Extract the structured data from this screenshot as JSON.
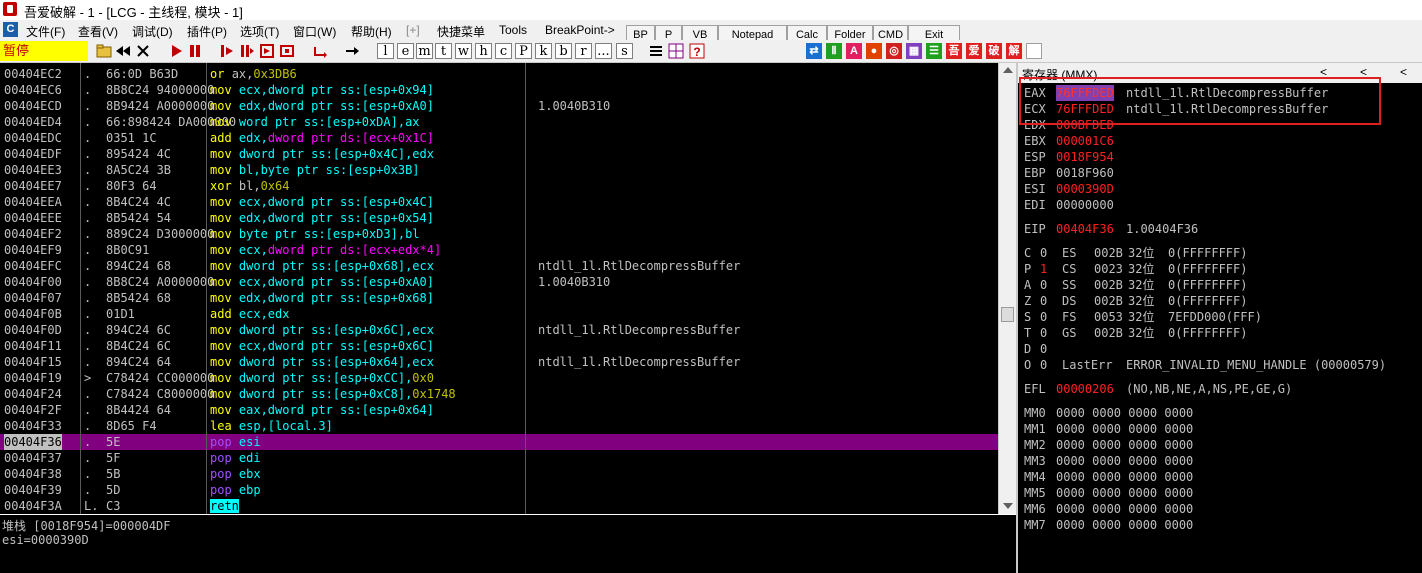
{
  "window": {
    "title": "吾爱破解 - 1 - [LCG - 主线程, 模块 - 1]"
  },
  "menu": {
    "items": [
      "文件(F)",
      "查看(V)",
      "调试(D)",
      "插件(P)",
      "选项(T)",
      "窗口(W)",
      "帮助(H)",
      "[+]",
      "快捷菜单",
      "Tools",
      "BreakPoint->"
    ]
  },
  "toolbar": {
    "status": "暂停",
    "letters": [
      "l",
      "e",
      "m",
      "t",
      "w",
      "h",
      "c",
      "P",
      "k",
      "b",
      "r",
      "...",
      "s"
    ],
    "plugin_buttons": [
      "BP",
      "P",
      "VB",
      "Notepad",
      "Calc",
      "Folder",
      "CMD",
      "Exit"
    ],
    "color_buttons": [
      "⇄",
      "Ⅱ",
      "A",
      "●",
      "◎",
      "▦",
      "☰",
      "吾",
      "爱",
      "破",
      "解"
    ]
  },
  "disasm": {
    "rows": [
      {
        "addr": "00404EC2",
        "mark": ".",
        "hex": "66:0D B63D",
        "asm": [
          {
            "t": "or ",
            "c": "y"
          },
          {
            "t": "ax,",
            "c": "w"
          },
          {
            "t": "0x3DB6",
            "c": "n"
          }
        ],
        "comment": ""
      },
      {
        "addr": "00404EC6",
        "mark": ".",
        "hex": "8B8C24 94000000",
        "asm": [
          {
            "t": "mov ",
            "c": "y"
          },
          {
            "t": "ecx",
            "c": "c"
          },
          {
            "t": ",dword ptr ss:[esp+0x94]",
            "c": "c"
          }
        ],
        "comment": ""
      },
      {
        "addr": "00404ECD",
        "mark": ".",
        "hex": "8B9424 A0000000",
        "asm": [
          {
            "t": "mov ",
            "c": "y"
          },
          {
            "t": "edx",
            "c": "c"
          },
          {
            "t": ",dword ptr ss:[esp+0xA0]",
            "c": "c"
          }
        ],
        "comment": "1.0040B310"
      },
      {
        "addr": "00404ED4",
        "mark": ".",
        "hex": "66:898424 DA000000",
        "asm": [
          {
            "t": "mov ",
            "c": "y"
          },
          {
            "t": "word ptr ss:[esp+0xDA],ax",
            "c": "c"
          }
        ],
        "comment": ""
      },
      {
        "addr": "00404EDC",
        "mark": ".",
        "hex": "0351 1C",
        "asm": [
          {
            "t": "add ",
            "c": "y"
          },
          {
            "t": "edx,",
            "c": "c"
          },
          {
            "t": "dword ptr ds:[ecx+0x1C]",
            "c": "m"
          }
        ],
        "comment": ""
      },
      {
        "addr": "00404EDF",
        "mark": ".",
        "hex": "895424 4C",
        "asm": [
          {
            "t": "mov ",
            "c": "y"
          },
          {
            "t": "dword ptr ss:[esp+0x4C],edx",
            "c": "c"
          }
        ],
        "comment": ""
      },
      {
        "addr": "00404EE3",
        "mark": ".",
        "hex": "8A5C24 3B",
        "asm": [
          {
            "t": "mov ",
            "c": "y"
          },
          {
            "t": "bl,byte ptr ss:[esp+0x3B]",
            "c": "c"
          }
        ],
        "comment": ""
      },
      {
        "addr": "00404EE7",
        "mark": ".",
        "hex": "80F3 64",
        "asm": [
          {
            "t": "xor ",
            "c": "y"
          },
          {
            "t": "bl,",
            "c": "w"
          },
          {
            "t": "0x64",
            "c": "n"
          }
        ],
        "comment": ""
      },
      {
        "addr": "00404EEA",
        "mark": ".",
        "hex": "8B4C24 4C",
        "asm": [
          {
            "t": "mov ",
            "c": "y"
          },
          {
            "t": "ecx,dword ptr ss:[esp+0x4C]",
            "c": "c"
          }
        ],
        "comment": ""
      },
      {
        "addr": "00404EEE",
        "mark": ".",
        "hex": "8B5424 54",
        "asm": [
          {
            "t": "mov ",
            "c": "y"
          },
          {
            "t": "edx,dword ptr ss:[esp+0x54]",
            "c": "c"
          }
        ],
        "comment": ""
      },
      {
        "addr": "00404EF2",
        "mark": ".",
        "hex": "889C24 D3000000",
        "asm": [
          {
            "t": "mov ",
            "c": "y"
          },
          {
            "t": "byte ptr ss:[esp+0xD3],bl",
            "c": "c"
          }
        ],
        "comment": ""
      },
      {
        "addr": "00404EF9",
        "mark": ".",
        "hex": "8B0C91",
        "asm": [
          {
            "t": "mov ",
            "c": "y"
          },
          {
            "t": "ecx,",
            "c": "c"
          },
          {
            "t": "dword ptr ds:[ecx+edx*4]",
            "c": "m"
          }
        ],
        "comment": ""
      },
      {
        "addr": "00404EFC",
        "mark": ".",
        "hex": "894C24 68",
        "asm": [
          {
            "t": "mov ",
            "c": "y"
          },
          {
            "t": "dword ptr ss:[esp+0x68],ecx",
            "c": "c"
          }
        ],
        "comment": "ntdll_1l.RtlDecompressBuffer"
      },
      {
        "addr": "00404F00",
        "mark": ".",
        "hex": "8B8C24 A0000000",
        "asm": [
          {
            "t": "mov ",
            "c": "y"
          },
          {
            "t": "ecx,dword ptr ss:[esp+0xA0]",
            "c": "c"
          }
        ],
        "comment": "1.0040B310"
      },
      {
        "addr": "00404F07",
        "mark": ".",
        "hex": "8B5424 68",
        "asm": [
          {
            "t": "mov ",
            "c": "y"
          },
          {
            "t": "edx,dword ptr ss:[esp+0x68]",
            "c": "c"
          }
        ],
        "comment": ""
      },
      {
        "addr": "00404F0B",
        "mark": ".",
        "hex": "01D1",
        "asm": [
          {
            "t": "add ",
            "c": "y"
          },
          {
            "t": "ecx,edx",
            "c": "c"
          }
        ],
        "comment": ""
      },
      {
        "addr": "00404F0D",
        "mark": ".",
        "hex": "894C24 6C",
        "asm": [
          {
            "t": "mov ",
            "c": "y"
          },
          {
            "t": "dword ptr ss:[esp+0x6C],ecx",
            "c": "c"
          }
        ],
        "comment": "ntdll_1l.RtlDecompressBuffer"
      },
      {
        "addr": "00404F11",
        "mark": ".",
        "hex": "8B4C24 6C",
        "asm": [
          {
            "t": "mov ",
            "c": "y"
          },
          {
            "t": "ecx,dword ptr ss:[esp+0x6C]",
            "c": "c"
          }
        ],
        "comment": ""
      },
      {
        "addr": "00404F15",
        "mark": ".",
        "hex": "894C24 64",
        "asm": [
          {
            "t": "mov ",
            "c": "y"
          },
          {
            "t": "dword ptr ss:[esp+0x64],ecx",
            "c": "c"
          }
        ],
        "comment": "ntdll_1l.RtlDecompressBuffer"
      },
      {
        "addr": "00404F19",
        "mark": ">",
        "hex": "C78424 CC000000",
        "asm": [
          {
            "t": "mov ",
            "c": "y"
          },
          {
            "t": "dword ptr ss:[esp+0xCC],",
            "c": "c"
          },
          {
            "t": "0x0",
            "c": "n"
          }
        ],
        "comment": ""
      },
      {
        "addr": "00404F24",
        "mark": ".",
        "hex": "C78424 C8000000",
        "asm": [
          {
            "t": "mov ",
            "c": "y"
          },
          {
            "t": "dword ptr ss:[esp+0xC8],",
            "c": "c"
          },
          {
            "t": "0x1748",
            "c": "n"
          }
        ],
        "comment": ""
      },
      {
        "addr": "00404F2F",
        "mark": ".",
        "hex": "8B4424 64",
        "asm": [
          {
            "t": "mov ",
            "c": "y"
          },
          {
            "t": "eax,dword ptr ss:[esp+0x64]",
            "c": "c"
          }
        ],
        "comment": ""
      },
      {
        "addr": "00404F33",
        "mark": ".",
        "hex": "8D65 F4",
        "asm": [
          {
            "t": "lea ",
            "c": "y"
          },
          {
            "t": "esp,[local.3]",
            "c": "c"
          }
        ],
        "comment": ""
      },
      {
        "addr": "00404F36",
        "mark": ".",
        "hex": "5E",
        "asm": [
          {
            "t": "pop ",
            "c": "p"
          },
          {
            "t": "esi",
            "c": "c"
          }
        ],
        "comment": "",
        "selected": true,
        "current": true
      },
      {
        "addr": "00404F37",
        "mark": ".",
        "hex": "5F",
        "asm": [
          {
            "t": "pop ",
            "c": "p"
          },
          {
            "t": "edi",
            "c": "c"
          }
        ],
        "comment": ""
      },
      {
        "addr": "00404F38",
        "mark": ".",
        "hex": "5B",
        "asm": [
          {
            "t": "pop ",
            "c": "p"
          },
          {
            "t": "ebx",
            "c": "c"
          }
        ],
        "comment": ""
      },
      {
        "addr": "00404F39",
        "mark": ".",
        "hex": "5D",
        "asm": [
          {
            "t": "pop ",
            "c": "p"
          },
          {
            "t": "ebp",
            "c": "c"
          }
        ],
        "comment": ""
      },
      {
        "addr": "00404F3A",
        "mark": "L.",
        "hex": "C3",
        "asm": [
          {
            "t": "retn",
            "c": "r"
          }
        ],
        "comment": ""
      }
    ]
  },
  "info": {
    "line1": "堆栈 [0018F954]=000004DF",
    "line2": "esi=0000390D"
  },
  "registers": {
    "header": "寄存器 (MMX)",
    "nav": [
      "<",
      "<",
      "<"
    ],
    "gp": [
      {
        "name": "EAX",
        "value": "76FFFDED",
        "comment": "ntdll_1l.RtlDecompressBuffer",
        "red": true,
        "hl": true
      },
      {
        "name": "ECX",
        "value": "76FFFDED",
        "comment": "ntdll_1l.RtlDecompressBuffer",
        "red": true
      },
      {
        "name": "EDX",
        "value": "000BFDED",
        "comment": "",
        "red": true
      },
      {
        "name": "EBX",
        "value": "000001C6",
        "comment": "",
        "red": true
      },
      {
        "name": "ESP",
        "value": "0018F954",
        "comment": "",
        "red": true
      },
      {
        "name": "EBP",
        "value": "0018F960",
        "comment": "",
        "red": false
      },
      {
        "name": "ESI",
        "value": "0000390D",
        "comment": "",
        "red": true
      },
      {
        "name": "EDI",
        "value": "00000000",
        "comment": "",
        "red": false
      }
    ],
    "eip": {
      "name": "EIP",
      "value": "00404F36",
      "comment": "1.00404F36"
    },
    "flags": [
      {
        "f": "C",
        "v": "0",
        "seg": "ES",
        "sel": "002B",
        "bits": "32位",
        "base": "0(FFFFFFFF)"
      },
      {
        "f": "P",
        "v": "1",
        "seg": "CS",
        "sel": "0023",
        "bits": "32位",
        "base": "0(FFFFFFFF)",
        "red": true
      },
      {
        "f": "A",
        "v": "0",
        "seg": "SS",
        "sel": "002B",
        "bits": "32位",
        "base": "0(FFFFFFFF)"
      },
      {
        "f": "Z",
        "v": "0",
        "seg": "DS",
        "sel": "002B",
        "bits": "32位",
        "base": "0(FFFFFFFF)"
      },
      {
        "f": "S",
        "v": "0",
        "seg": "FS",
        "sel": "0053",
        "bits": "32位",
        "base": "7EFDD000(FFF)"
      },
      {
        "f": "T",
        "v": "0",
        "seg": "GS",
        "sel": "002B",
        "bits": "32位",
        "base": "0(FFFFFFFF)"
      },
      {
        "f": "D",
        "v": "0",
        "seg": "",
        "sel": "",
        "bits": "",
        "base": ""
      },
      {
        "f": "O",
        "v": "0",
        "seg": "LastErr",
        "sel": "",
        "bits": "",
        "base": "ERROR_INVALID_MENU_HANDLE (00000579)"
      }
    ],
    "efl": {
      "name": "EFL",
      "value": "00000206",
      "comment": "(NO,NB,NE,A,NS,PE,GE,G)"
    },
    "mmx": [
      {
        "name": "MM0",
        "value": "0000 0000 0000 0000"
      },
      {
        "name": "MM1",
        "value": "0000 0000 0000 0000"
      },
      {
        "name": "MM2",
        "value": "0000 0000 0000 0000"
      },
      {
        "name": "MM3",
        "value": "0000 0000 0000 0000"
      },
      {
        "name": "MM4",
        "value": "0000 0000 0000 0000"
      },
      {
        "name": "MM5",
        "value": "0000 0000 0000 0000"
      },
      {
        "name": "MM6",
        "value": "0000 0000 0000 0000"
      },
      {
        "name": "MM7",
        "value": "0000 0000 0000 0000"
      }
    ]
  },
  "colors": {
    "selected_row": "#800080",
    "accent_red": "#ff2020",
    "highlight_box": "#e02020",
    "status_bg": "#ffff00"
  }
}
